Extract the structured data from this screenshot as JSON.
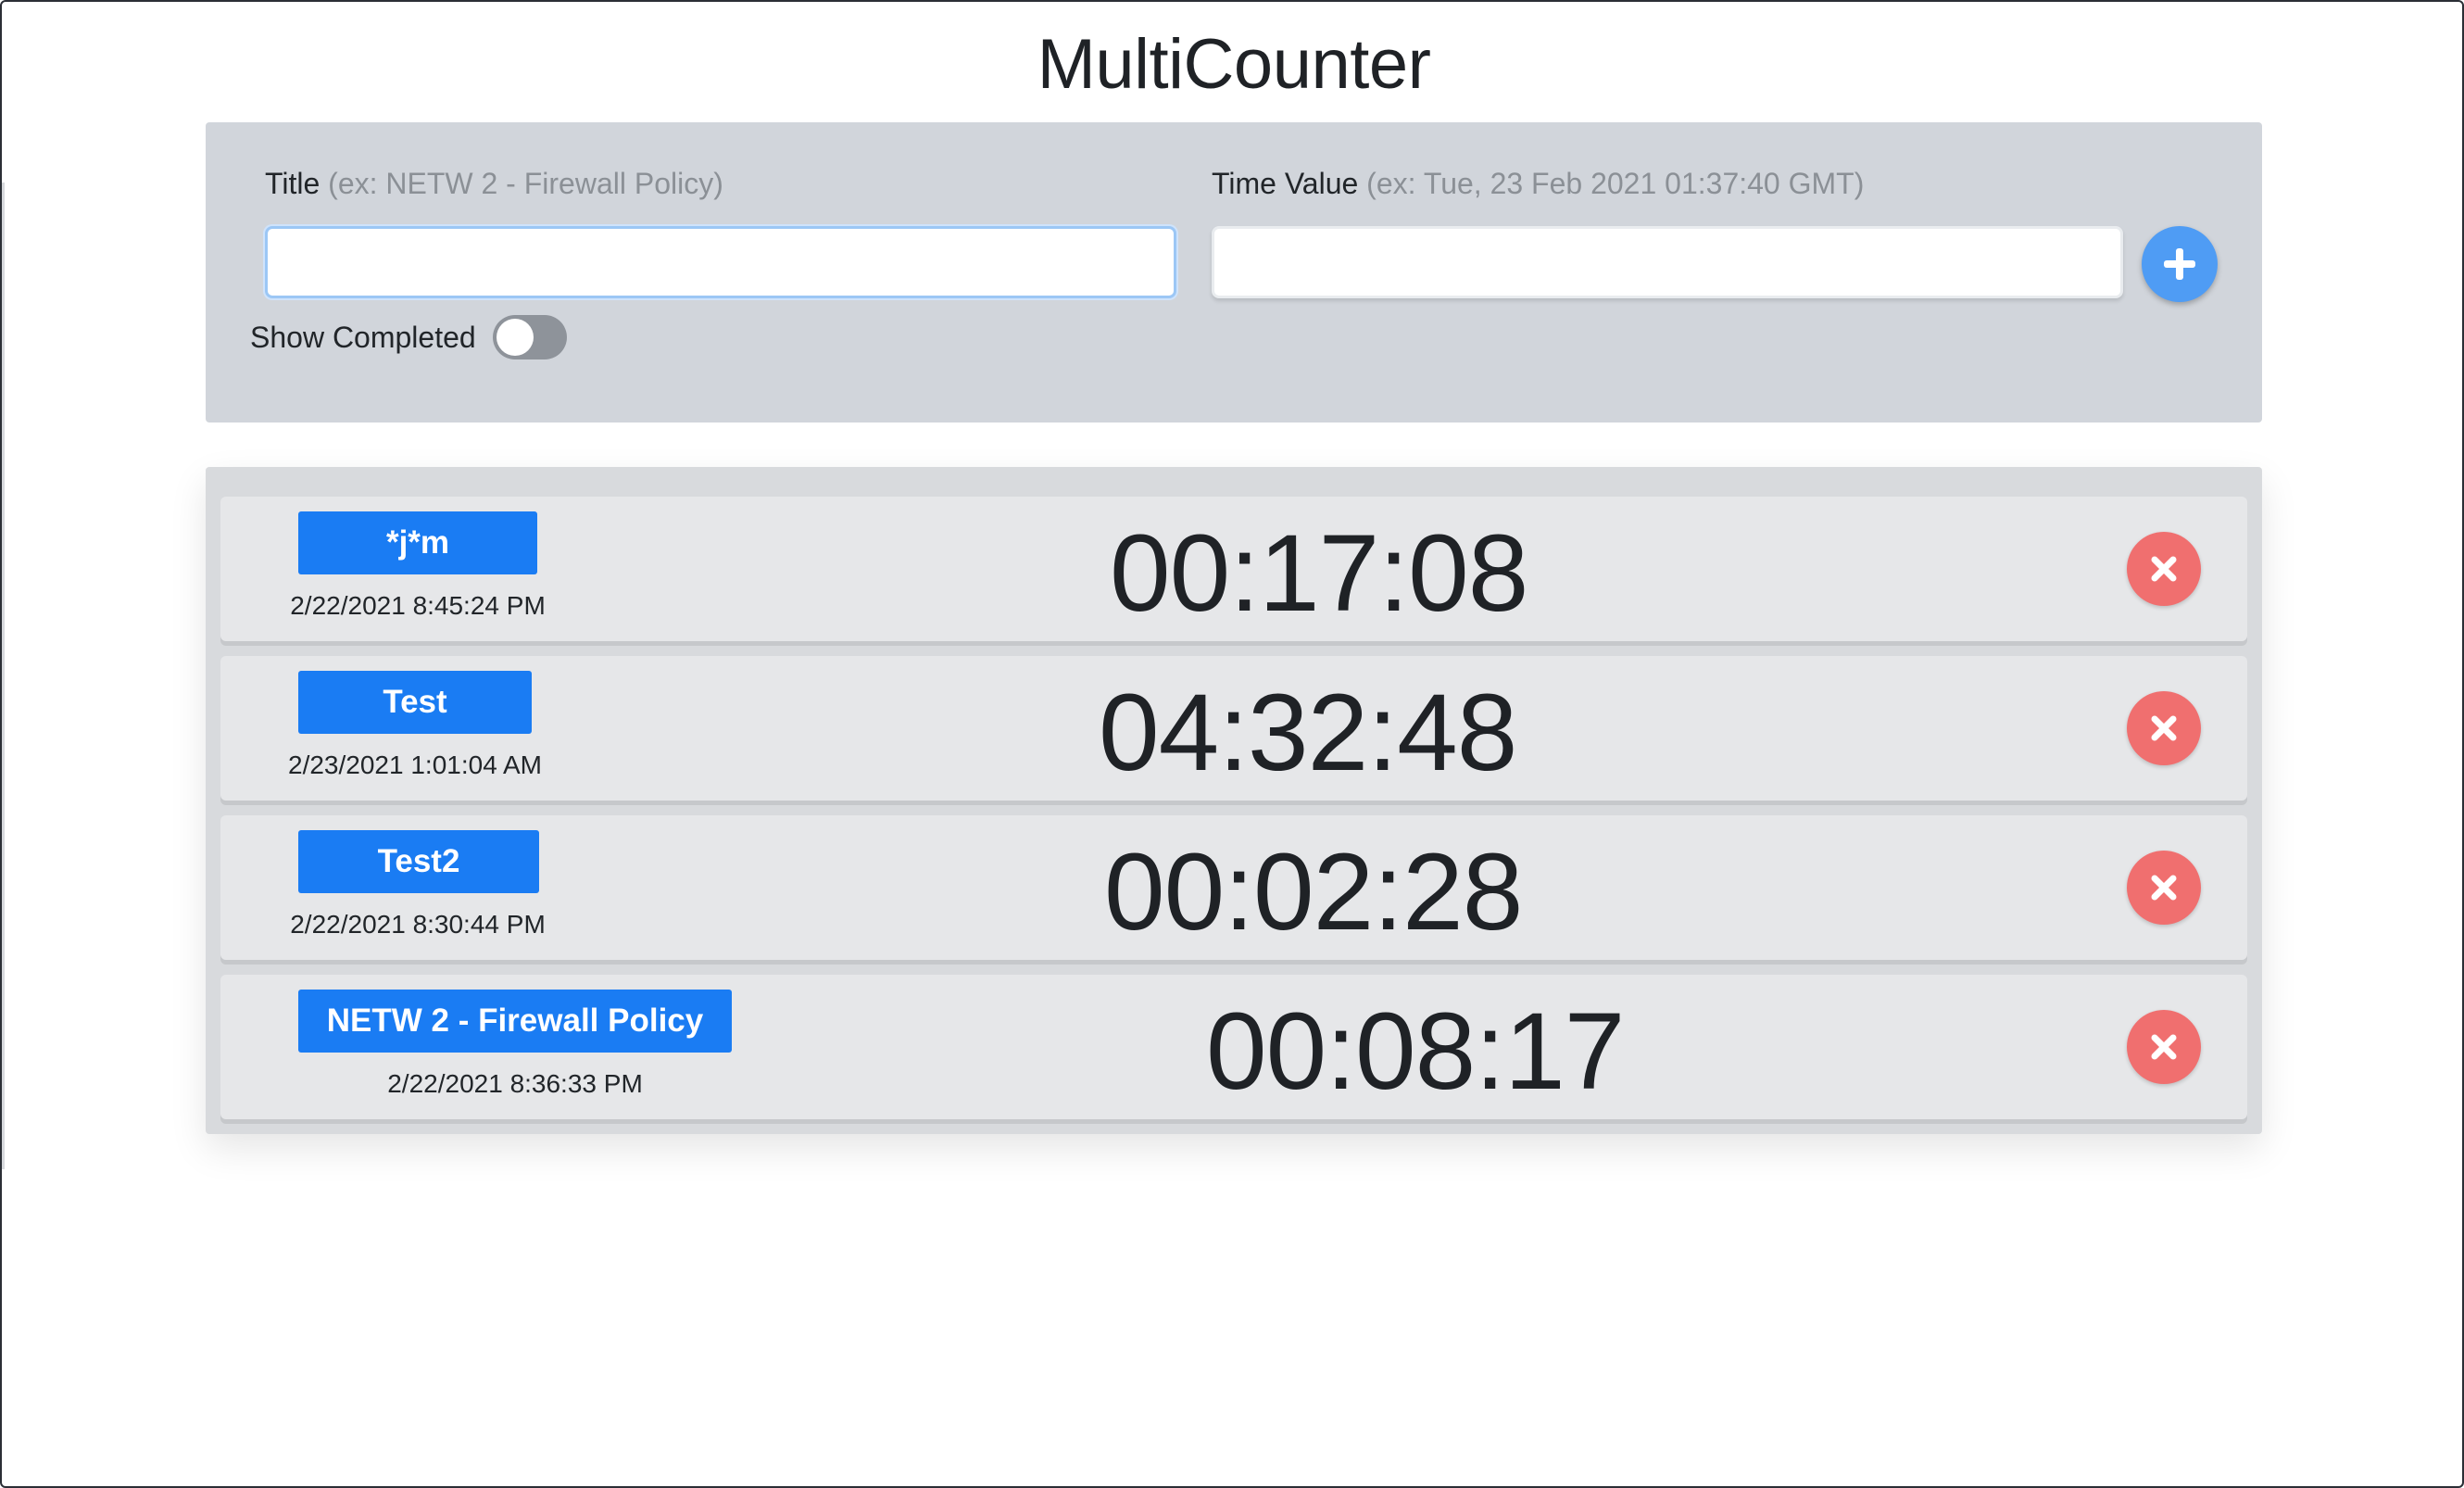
{
  "app": {
    "title": "MultiCounter"
  },
  "form": {
    "title_label": "Title",
    "title_hint": "(ex: NETW 2 - Firewall Policy)",
    "title_value": "",
    "time_label": "Time Value",
    "time_hint": "(ex: Tue, 23 Feb 2021 01:37:40 GMT)",
    "time_value": "",
    "add_icon": "plus-icon",
    "show_completed_label": "Show Completed",
    "show_completed_on": false
  },
  "counters": [
    {
      "title": "*j*m",
      "start": "2/22/2021 8:45:24 PM",
      "elapsed": "00:17:08",
      "delete_icon": "close-icon"
    },
    {
      "title": "Test",
      "start": "2/23/2021 1:01:04 AM",
      "elapsed": "04:32:48",
      "delete_icon": "close-icon"
    },
    {
      "title": "Test2",
      "start": "2/22/2021 8:30:44 PM",
      "elapsed": "00:02:28",
      "delete_icon": "close-icon"
    },
    {
      "title": "NETW 2 - Firewall Policy",
      "start": "2/22/2021 8:36:33 PM",
      "elapsed": "00:08:17",
      "delete_icon": "close-icon"
    }
  ],
  "colors": {
    "accent": "#1a7cf3",
    "add_button": "#4f9cf4",
    "delete_button": "#f06f6f",
    "form_panel": "#d1d5db",
    "list_panel": "#d8dadd"
  }
}
